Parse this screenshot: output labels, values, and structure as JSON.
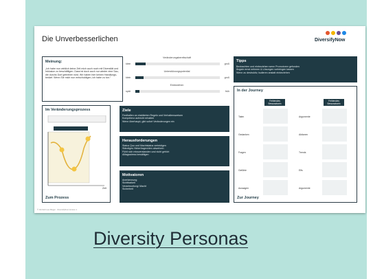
{
  "card": {
    "caption": "Diversity Personas",
    "accent": "#b7e3dc",
    "dark": "#1f3a44"
  },
  "slide": {
    "title": "Die Unverbesserlichen",
    "logo": "DiversifyNow",
    "footer": "© Vertrieb Lea Rieger · DiversifyNow Version 1",
    "meinung": {
      "heading": "Meinung:",
      "quote": "„Ich habe nun wirklich keine Zeit mich auch noch mit Diversität und Inklusion zu beschäftigen. Dass ist doch auch nur wieder eine Sau, die durchs Dorf getrieben wird. Wir haben hier keinen Handlungs-bedarf. Wenn Sie mich nun entschuldigen, ich habe zu tun.“"
    },
    "scales": [
      {
        "label": "Veränderungsbereitschaft",
        "low": "klein",
        "high": "groß",
        "level": 0.12
      },
      {
        "label": "Unterstützungspotential",
        "low": "klein",
        "high": "groß",
        "level": 0.1
      },
      {
        "label": "Einbeziehen",
        "low": "spät",
        "high": "früh",
        "level": 0.05
      }
    ],
    "tipps": {
      "heading": "Tipps",
      "items": [
        "Beobachten und einbeziehen wenn Promotoren gefunden",
        "Ängste ernst nehmen & Lösungen vorbringen lassen",
        "Wenn zu destruktiv, isolieren anstatt einbeziehen"
      ]
    },
    "prozess": {
      "heading": "Im Veränderungsprozess",
      "link": "Zum Prozess",
      "axis": "Zeit"
    },
    "ziele": {
      "heading": "Ziele",
      "items": [
        "Festhalten an etablierten Regeln und Verhaltensweisen",
        "Kompetenz aufrecht erhalten",
        "Wenn überhaupt, gibt sofort Veränderungen ein"
      ]
    },
    "herausforderungen": {
      "heading": "Herausforderungen",
      "items": [
        "Status Quo und Machtstatus verteidigen",
        "Ständiges Hinterfragen/den abwehren",
        "Fühlt sich missverstanden und nicht gehört",
        "Alltagsstress bewältigen"
      ]
    },
    "motivatoren": {
      "heading": "Motivatoren",
      "items": [
        "Anerkennung",
        "Sichtbarkeit",
        "Verantwortung/ Macht",
        "Sicherheit"
      ]
    },
    "journey": {
      "heading": "In der Journey",
      "link": "Zur Journey",
      "col_left": "Fehlendes Bewusstsein",
      "col_right": "Fehlendes Bewusstsein",
      "rows_left": [
        "Taten",
        "Gedanken",
        "Fragen",
        "Gefühle",
        "Aussagen"
      ],
      "rows_right": [
        "Argumente",
        "Aktionen",
        "Trends",
        "Elfs",
        "Argumente"
      ]
    }
  }
}
